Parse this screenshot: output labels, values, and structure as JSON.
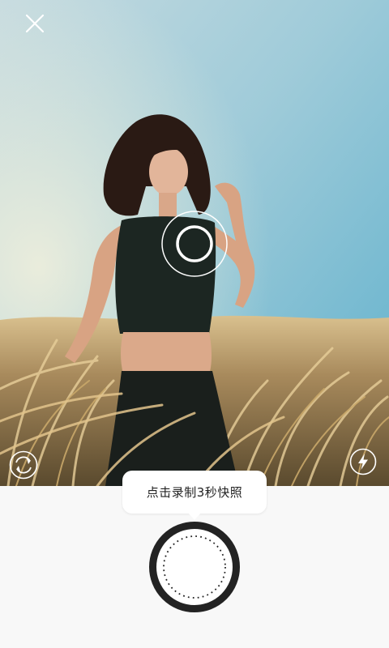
{
  "camera": {
    "preview_description": "",
    "close_icon": "close-icon",
    "focus_icon": "focus-ring-icon",
    "switch_icon": "switch-camera-icon",
    "flash_icon": "flash-icon"
  },
  "capture": {
    "tooltip_text": "点击录制3秒快照",
    "shutter_icon": "shutter-icon"
  },
  "colors": {
    "panel_background": "#f8f8f8",
    "shutter_ring": "#222222",
    "tooltip_background": "#ffffff"
  }
}
